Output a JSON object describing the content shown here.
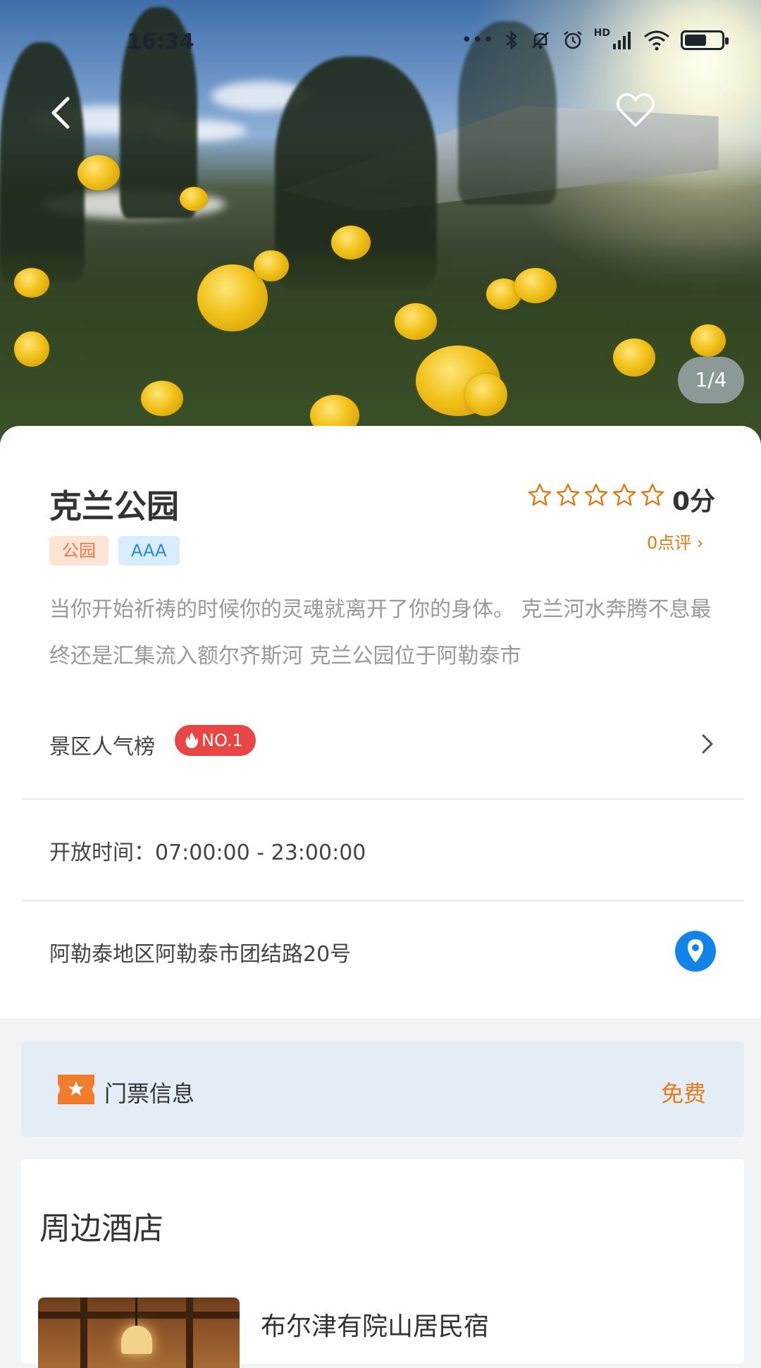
{
  "status_bar": {
    "time": "16:34",
    "icons": [
      "more-dots-icon",
      "bluetooth-icon",
      "mute-icon",
      "alarm-icon",
      "hd-signal-icon",
      "wifi-icon",
      "battery-icon"
    ],
    "hd_label": "HD",
    "battery_level": 0.6
  },
  "gallery": {
    "counter": "1/4"
  },
  "attraction": {
    "name": "克兰公园",
    "score": "0分",
    "rating_stars": 0,
    "reviews": "0点评",
    "tags": [
      "公园",
      "AAA"
    ],
    "description": "当你开始祈祷的时候你的灵魂就离开了你的身体。 克兰河水奔腾不息最终还是汇集流入额尔齐斯河 克兰公园位于阿勒泰市"
  },
  "ranking": {
    "label": "景区人气榜",
    "badge": "NO.1"
  },
  "hours": {
    "text": "开放时间：07:00:00 - 23:00:00"
  },
  "address": {
    "text": "阿勒泰地区阿勒泰市团结路20号"
  },
  "ticket": {
    "label": "门票信息",
    "price": "免费"
  },
  "hotels": {
    "title": "周边酒店",
    "items": [
      {
        "name": "布尔津有院山居民宿"
      }
    ]
  },
  "colors": {
    "accent_orange": "#e07a12",
    "badge_red": "#e84545",
    "location_blue": "#1283e8"
  }
}
